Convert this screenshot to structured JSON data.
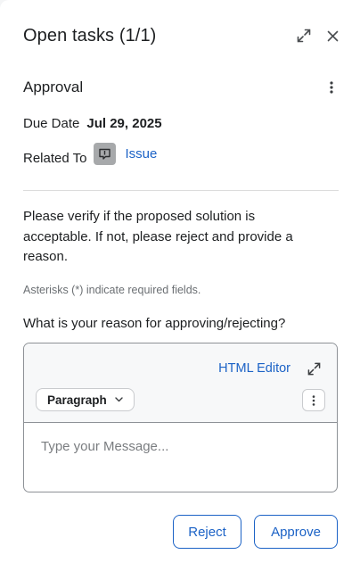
{
  "header": {
    "title": "Open tasks (1/1)",
    "expand_icon": "expand-icon",
    "close_icon": "close-icon"
  },
  "task": {
    "title": "Approval",
    "more_icon": "kebab-vertical-icon",
    "due_date_label": "Due Date",
    "due_date_value": "Jul 29, 2025",
    "related_to_label": "Related To",
    "related_icon": "record-icon",
    "related_link": "Issue"
  },
  "body": {
    "message": "Please verify if the proposed solution is acceptable. If not, please reject and provide a reason.",
    "asterisk_note": "Asterisks (*) indicate required fields.",
    "question": "What is your reason for approving/rejecting?"
  },
  "editor": {
    "html_editor_label": "HTML Editor",
    "expand_icon": "expand-icon",
    "format_selected": "Paragraph",
    "format_icon": "chevron-down-icon",
    "more_icon": "kebab-vertical-icon",
    "placeholder": "Type your Message..."
  },
  "actions": {
    "reject_label": "Reject",
    "approve_label": "Approve"
  },
  "colors": {
    "link": "#1b62c6",
    "border": "#8d9196",
    "record_icon_bg": "#a7a9ab"
  }
}
